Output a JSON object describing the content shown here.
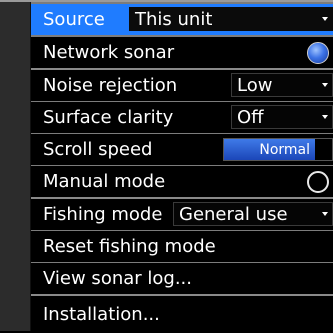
{
  "menu": {
    "source": {
      "label": "Source",
      "value": "This unit"
    },
    "network_sonar": {
      "label": "Network sonar",
      "enabled": true
    },
    "noise_rejection": {
      "label": "Noise rejection",
      "value": "Low"
    },
    "surface_clarity": {
      "label": "Surface clarity",
      "value": "Off"
    },
    "scroll_speed": {
      "label": "Scroll speed",
      "value": "Normal",
      "level": 0.84
    },
    "manual_mode": {
      "label": "Manual mode",
      "enabled": false
    },
    "fishing_mode": {
      "label": "Fishing mode",
      "value": "General use"
    },
    "reset_fishing_mode": {
      "label": "Reset fishing mode"
    },
    "view_sonar_log": {
      "label": "View sonar log..."
    },
    "installation": {
      "label": "Installation..."
    }
  },
  "colors": {
    "selection": "#1f7cff",
    "toggle_on": "#3d73e6",
    "slider_fill": "#2b5fd6",
    "background": "#000000"
  }
}
